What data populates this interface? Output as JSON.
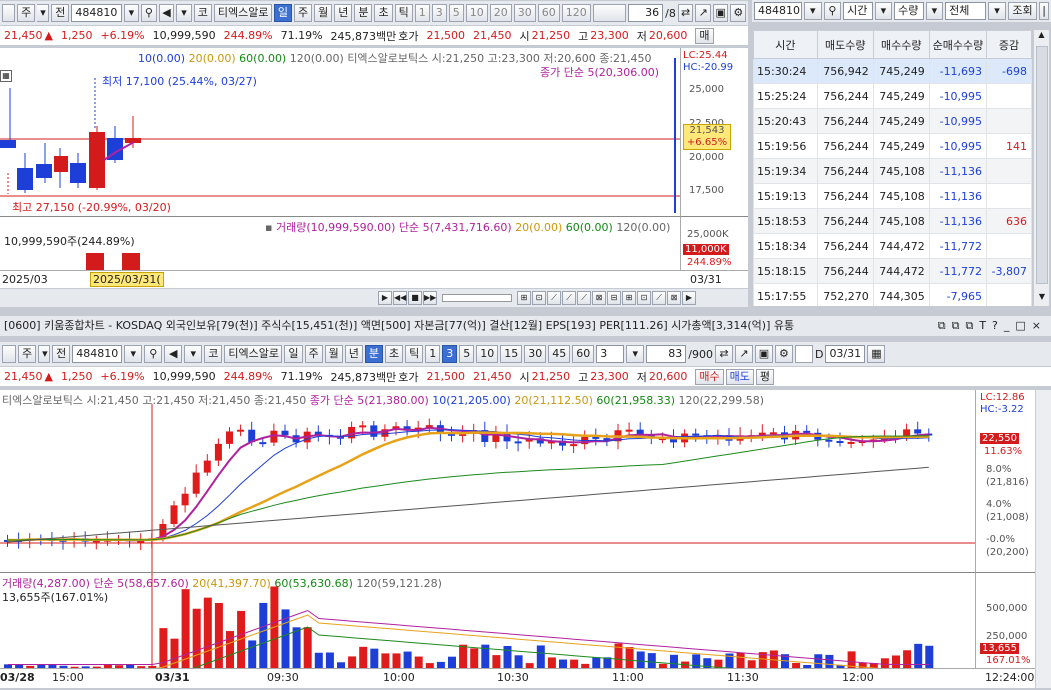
{
  "top": {
    "market_sel": "주",
    "period_sel": "전",
    "code": "484810",
    "name": "티엑스알로",
    "tabs": [
      "일",
      "주",
      "월",
      "년",
      "분",
      "초",
      "틱"
    ],
    "nums": [
      "1",
      "3",
      "5",
      "10",
      "20",
      "30",
      "60",
      "120"
    ],
    "count": "36",
    "count_total": "/8",
    "info": {
      "price": "21,450",
      "arrow": "▲",
      "chg": "1,250",
      "pct": "+6.19%",
      "vol": "10,999,590",
      "vr": "244.89%",
      "ratio": "71.19%",
      "amt": "245,873백만",
      "ask_l": "호가",
      "ask": "21,500",
      "bid": "21,450",
      "s_l": "시",
      "s": "21,250",
      "h_l": "고",
      "h": "23,300",
      "l_l": "저",
      "lo": "20,600",
      "sell": "매"
    },
    "legend": {
      "a": "10(0.00)",
      "b": "20(0.00)",
      "c": "60(0.00)",
      "d": "120(0.00)",
      "name": "티엑스알로보틱스 시:21,250 고:23,300 저:20,600 종:21,450",
      "lc": "LC:25.44",
      "hc": "HC:-20.99",
      "ma": "종가 단순 5(20,306.00)"
    },
    "low_label": "최저 17,100 (25.44%, 03/27)",
    "high_label": "최고 27,150 (-20.99%, 03/20)",
    "yticks": [
      "25,000",
      "22,500",
      "20,000",
      "17,500"
    ],
    "price_tag": "21,543",
    "price_pct": "+6.65%",
    "vol_legend": {
      "a": "거래량(10,999,590.00)",
      "b": "단순 5(7,431,716.60)",
      "c": "20(0.00)",
      "d": "60(0.00)",
      "e": "120(0.00)"
    },
    "vol_label": "10,999,590주(244.89%)",
    "vol_ticks": [
      "25,000K",
      "11,000K",
      "244.89%"
    ],
    "date_left": "2025/03",
    "date_cursor": "2025/03/31(",
    "date_right": "03/31"
  },
  "trade": {
    "code": "484810",
    "sel_time": "시간",
    "sel_qty": "수량",
    "sel_all": "전체",
    "query": "조회",
    "headers": [
      "시간",
      "매도수량",
      "매수수량",
      "순매수수량",
      "증감"
    ],
    "rows": [
      [
        "15:30:24",
        "756,942",
        "745,249",
        "-11,693",
        "-698"
      ],
      [
        "15:25:24",
        "756,244",
        "745,249",
        "-10,995",
        ""
      ],
      [
        "15:20:43",
        "756,244",
        "745,249",
        "-10,995",
        ""
      ],
      [
        "15:19:56",
        "756,244",
        "745,249",
        "-10,995",
        "141"
      ],
      [
        "15:19:34",
        "756,244",
        "745,108",
        "-11,136",
        ""
      ],
      [
        "15:19:13",
        "756,244",
        "745,108",
        "-11,136",
        ""
      ],
      [
        "15:18:53",
        "756,244",
        "745,108",
        "-11,136",
        "636"
      ],
      [
        "15:18:34",
        "756,244",
        "744,472",
        "-11,772",
        ""
      ],
      [
        "15:18:15",
        "756,244",
        "744,472",
        "-11,772",
        "-3,807"
      ],
      [
        "15:17:55",
        "752,270",
        "744,305",
        "-7,965",
        ""
      ]
    ]
  },
  "bottom": {
    "title": "[0600] 키움종합차트 - KOSDAQ 외국인보유[79(천)] 주식수[15,451(천)] 액면[500] 자본금[77(억)] 결산[12월] EPS[193] PER[111.26] 시가총액[3,314(억)] 유통",
    "market_sel": "주",
    "period_sel": "전",
    "code": "484810",
    "name": "티엑스알로",
    "tabs": [
      "일",
      "주",
      "월",
      "년",
      "분",
      "초",
      "틱"
    ],
    "nums": [
      "1",
      "3",
      "5",
      "10",
      "15",
      "30",
      "45",
      "60"
    ],
    "interval": "3",
    "count": "83",
    "count_total": "/900",
    "d_label": "D",
    "date": "03/31",
    "info": {
      "price": "21,450",
      "arrow": "▲",
      "chg": "1,250",
      "pct": "+6.19%",
      "vol": "10,999,590",
      "vr": "244.89%",
      "ratio": "71.19%",
      "amt": "245,873백만",
      "ask_l": "호가",
      "ask": "21,500",
      "bid": "21,450",
      "s_l": "시",
      "s": "21,250",
      "h_l": "고",
      "h": "23,300",
      "l_l": "저",
      "lo": "20,600",
      "sell": "매수",
      "buy": "매도",
      "flat": "평"
    },
    "legend": {
      "name": "티엑스알로보틱스 시:21,450 고:21,450 저:21,450 종:21,450",
      "ma5": "종가 단순 5(21,380.00)",
      "ma10": "10(21,205.00)",
      "ma20": "20(21,112.50)",
      "ma60": "60(21,958.33)",
      "ma120": "120(22,299.58)"
    },
    "right": {
      "lc": "LC:12.86",
      "hc": "HC:-3.22",
      "tag": "22,550",
      "tag_pct": "11.63%",
      "p1": "8.0%",
      "p1v": "(21,816)",
      "p2": "4.0%",
      "p2v": "(21,008)",
      "p3": "-0.0%",
      "p3v": "(20,200)"
    },
    "vol_legend": {
      "a": "거래량(4,287.00)",
      "b": "단순 5(58,657.60)",
      "c": "20(41,397.70)",
      "d": "60(53,630.68)",
      "e": "120(59,121.28)"
    },
    "vol_label": "13,655주(167.01%)",
    "vol_ticks": [
      "500,000",
      "250,000",
      "13,655",
      "167.01%"
    ],
    "xticks": [
      "03/28",
      "15:00",
      "03/31",
      "09:30",
      "10:00",
      "10:30",
      "11:00",
      "11:30",
      "12:00",
      "12:24:00"
    ]
  },
  "colors": {
    "up": "#e01b1b",
    "down": "#1d3fd8",
    "ma5": "#b0219e",
    "ma20": "#e8a21a",
    "ma60": "#1d8a1d",
    "ma120": "#555555"
  }
}
